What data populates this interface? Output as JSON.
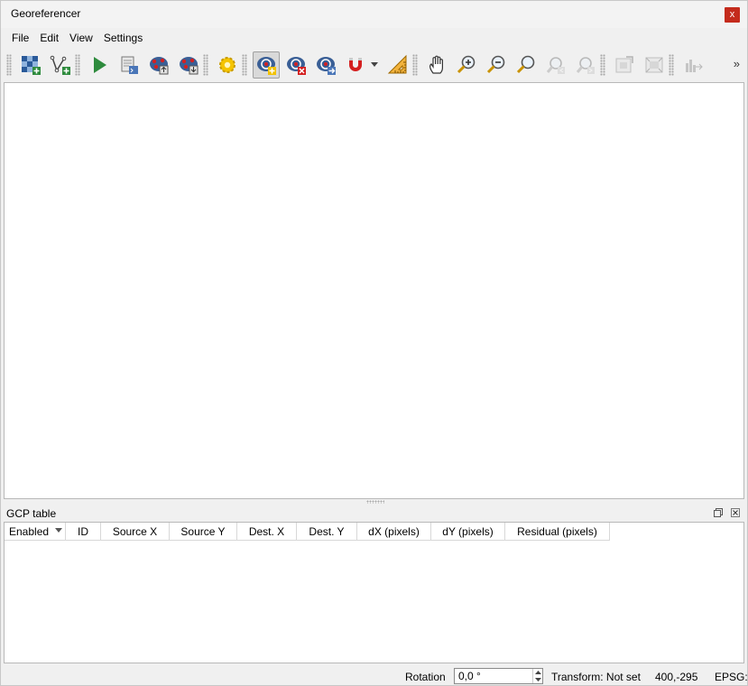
{
  "window": {
    "title": "Georeferencer",
    "close_label": "x"
  },
  "menu": [
    "File",
    "Edit",
    "View",
    "Settings"
  ],
  "toolbar": {
    "groups": [
      [
        "open-raster-icon",
        "start-georeferencing-icon"
      ],
      [
        "start-icon",
        "generate-gdal-script-icon",
        "load-gcp-points-icon",
        "save-gcp-points-icon"
      ],
      [
        "transformation-settings-icon"
      ],
      [
        "add-point-icon",
        "delete-point-icon",
        "move-gcp-point-icon",
        "snap-magnet-icon",
        "measure-ruler-icon"
      ],
      [
        "pan-icon",
        "zoom-in-icon",
        "zoom-out-icon",
        "zoom-to-layer-icon",
        "zoom-last-icon",
        "zoom-next-icon"
      ],
      [
        "link-georef-to-qgis-icon",
        "link-qgis-to-georef-icon"
      ],
      [
        "full-histogram-stretch-icon"
      ]
    ],
    "overflow": "»"
  },
  "gcp_panel": {
    "title": "GCP table",
    "columns": [
      "Enabled",
      "ID",
      "Source X",
      "Source Y",
      "Dest. X",
      "Dest. Y",
      "dX (pixels)",
      "dY (pixels)",
      "Residual (pixels)"
    ],
    "rows": []
  },
  "status": {
    "rotation_label": "Rotation",
    "rotation_value": "0,0 °",
    "transform": "Transform: Not set",
    "coords": "400,-295",
    "epsg": "EPSG:"
  },
  "colors": {
    "accent_red": "#c42b1c",
    "blue": "#3a6fb0",
    "green": "#2e8b3d"
  }
}
